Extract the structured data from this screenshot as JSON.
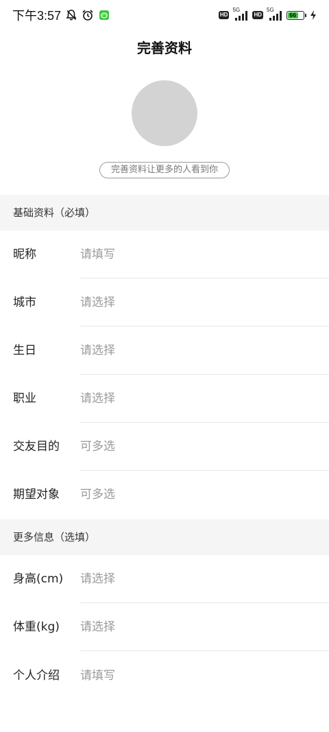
{
  "status_bar": {
    "time": "下午3:57",
    "signal_1_label": "5G",
    "signal_2_label": "5G",
    "battery_level": "66",
    "colors": {
      "battery_fill": "#3cc83c",
      "wechat_badge": "#3cc83c"
    },
    "icons": [
      "mute-bell-icon",
      "alarm-icon",
      "wechat-notification-icon",
      "hd-badge",
      "signal-icon",
      "battery-icon",
      "charging-icon"
    ]
  },
  "header": {
    "title": "完善资料"
  },
  "avatar": {
    "hint": "完善资料让更多的人看到你",
    "placeholder_color": "#d3d3d3"
  },
  "sections": {
    "basic": {
      "title": "基础资料（必填）",
      "rows": [
        {
          "label": "昵称",
          "value": "请填写"
        },
        {
          "label": "城市",
          "value": "请选择"
        },
        {
          "label": "生日",
          "value": "请选择"
        },
        {
          "label": "职业",
          "value": "请选择"
        },
        {
          "label": "交友目的",
          "value": "可多选"
        },
        {
          "label": "期望对象",
          "value": "可多选"
        }
      ]
    },
    "more": {
      "title": "更多信息（选填）",
      "rows": [
        {
          "label": "身高(cm)",
          "value": "请选择"
        },
        {
          "label": "体重(kg)",
          "value": "请选择"
        },
        {
          "label": "个人介绍",
          "value": "请填写"
        }
      ]
    }
  }
}
